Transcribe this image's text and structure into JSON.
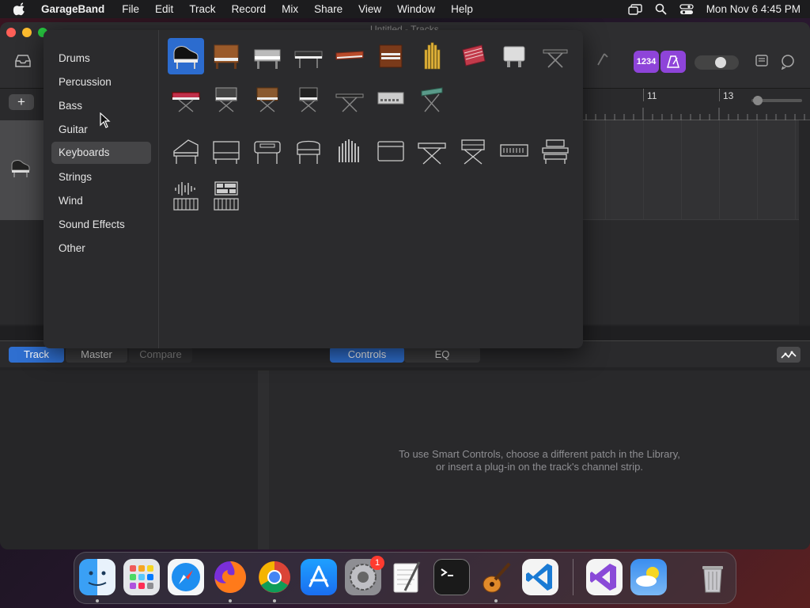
{
  "menubar": {
    "app_name": "GarageBand",
    "items": [
      "File",
      "Edit",
      "Track",
      "Record",
      "Mix",
      "Share",
      "View",
      "Window",
      "Help"
    ],
    "clock": "Mon Nov 6  4:45 PM"
  },
  "window": {
    "title": "Untitled - Tracks"
  },
  "toolbar": {
    "count_in_label": "1234",
    "add_track_label": "+"
  },
  "ruler": {
    "bar_11": "11",
    "bar_13": "13"
  },
  "library": {
    "categories": [
      "Drums",
      "Percussion",
      "Bass",
      "Guitar",
      "Keyboards",
      "Strings",
      "Wind",
      "Sound Effects",
      "Other"
    ],
    "selected_category": "Keyboards"
  },
  "smart_controls": {
    "tabs": {
      "track": "Track",
      "master": "Master",
      "compare": "Compare",
      "controls": "Controls",
      "eq": "EQ"
    },
    "message_line1": "To use Smart Controls, choose a different patch in the Library,",
    "message_line2": "or insert a plug-in on the track's channel strip."
  },
  "dock": {
    "system_prefs_badge": "1"
  },
  "colors": {
    "accent_blue": "#2c6ccf",
    "accent_purple": "#8e44d9"
  }
}
